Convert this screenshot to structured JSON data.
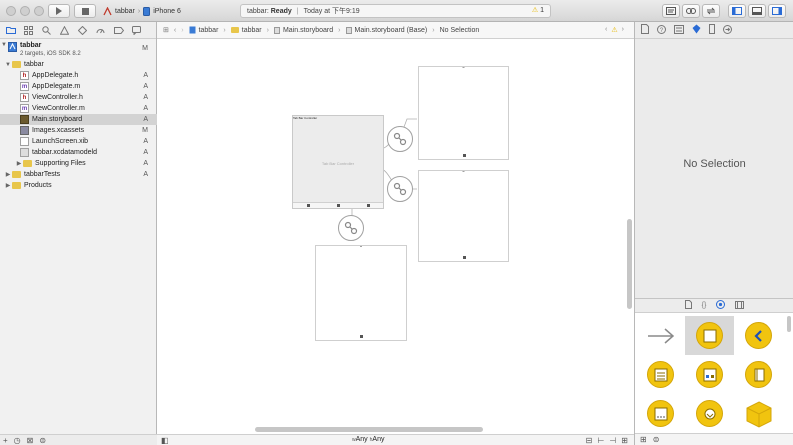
{
  "toolbar": {
    "scheme_target": "tabbar",
    "scheme_device": "iPhone 6",
    "activity_project": "tabbar:",
    "activity_status": "Ready",
    "activity_time": "Today at 下午9:19",
    "warning_count": "1"
  },
  "navigator": {
    "items": [
      {
        "label": "tabbar",
        "sublabel": "2 targets, iOS SDK 8.2",
        "badge": "M"
      },
      {
        "label": "tabbar",
        "badge": ""
      },
      {
        "label": "AppDelegate.h",
        "badge": "A"
      },
      {
        "label": "AppDelegate.m",
        "badge": "A"
      },
      {
        "label": "ViewController.h",
        "badge": "A"
      },
      {
        "label": "ViewController.m",
        "badge": "A"
      },
      {
        "label": "Main.storyboard",
        "badge": "A"
      },
      {
        "label": "Images.xcassets",
        "badge": "M"
      },
      {
        "label": "LaunchScreen.xib",
        "badge": "A"
      },
      {
        "label": "tabbar.xcdatamodeld",
        "badge": "A"
      },
      {
        "label": "Supporting Files",
        "badge": "A"
      },
      {
        "label": "tabbarTests",
        "badge": "A"
      },
      {
        "label": "Products",
        "badge": ""
      }
    ]
  },
  "jumpbar": {
    "crumbs": [
      "tabbar",
      "tabbar",
      "Main.storyboard",
      "Main.storyboard (Base)",
      "No Selection"
    ]
  },
  "canvas": {
    "tab_bar_controller_title": "Tab Bar Controller",
    "tab_bar_controller_label": "Tab Bar Controller"
  },
  "size_class": {
    "w_prefix": "w",
    "w_value": "Any",
    "h_prefix": "h",
    "h_value": "Any"
  },
  "inspector": {
    "no_selection": "No Selection"
  },
  "colors": {
    "library_accent": "#f1c40f",
    "selection": "#d3d3d3",
    "warning": "#e6b800"
  }
}
